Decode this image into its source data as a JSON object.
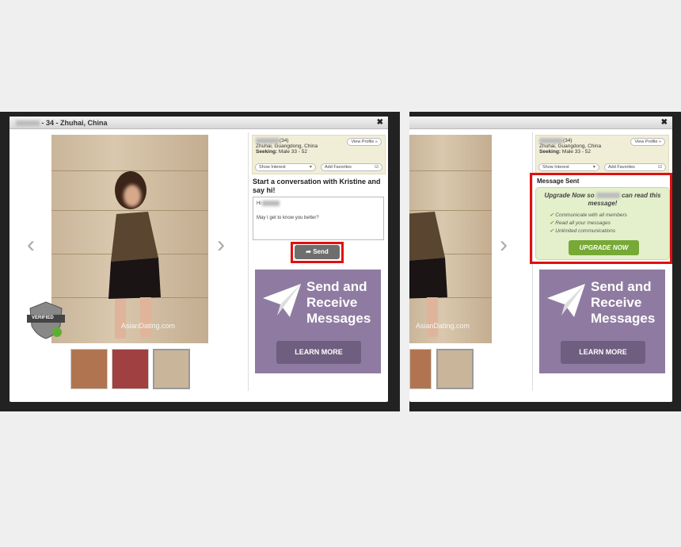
{
  "left": {
    "title_suffix": "- 34 - Zhuhai, China",
    "close": "✖",
    "watermark": "AsianDating.com",
    "verified_badge": "VERIFIED",
    "profile": {
      "age": "(34)",
      "location": "Zhuhai, Guangdong, China",
      "seeking_label": "Seeking:",
      "seeking_value": "Male 33 - 52",
      "view_profile": "View Profile »",
      "show_interest": "Show Interest",
      "add_favorites": "Add Favorites"
    },
    "heading": "Start a conversation with Kristine and say hi!",
    "message_greeting": "Hi",
    "message_body": "May I get to know you better?",
    "send": "Send",
    "ad": {
      "text": "Send and Receive Messages",
      "button": "LEARN MORE"
    }
  },
  "right": {
    "close": "✖",
    "watermark": "AsianDating.com",
    "profile": {
      "age": "(34)",
      "location": "Zhuhai, Guangdong, China",
      "seeking_label": "Seeking:",
      "seeking_value": "Male 33 - 52",
      "view_profile": "View Profile »",
      "show_interest": "Show Interest",
      "add_favorites": "Add Favorites"
    },
    "status": "Message Sent",
    "upgrade_prefix": "Upgrade Now so",
    "upgrade_suffix": "can read this message!",
    "benefits": [
      "Communicate with all members",
      "Read all your messages",
      "Unlimited communications"
    ],
    "upgrade_button": "UPGRADE NOW",
    "ad": {
      "text": "Send and Receive Messages",
      "button": "LEARN MORE"
    }
  },
  "colors": {
    "highlight": "#e01010",
    "ad": "#8f7ba1",
    "upgrade": "#77a936"
  }
}
